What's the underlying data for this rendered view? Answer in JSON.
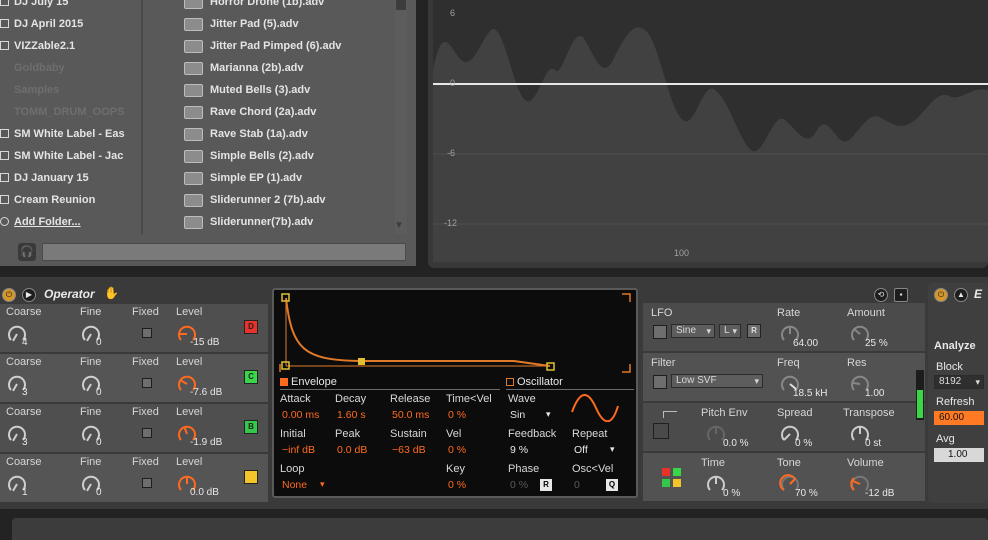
{
  "browser": {
    "places": [
      {
        "label": "DJ July 15",
        "checkbox": true,
        "dim": false
      },
      {
        "label": "DJ April 2015",
        "checkbox": true,
        "dim": false
      },
      {
        "label": "VIZZable2.1",
        "checkbox": true,
        "dim": false
      },
      {
        "label": "Goldbaby",
        "checkbox": false,
        "dim": true
      },
      {
        "label": "Samples",
        "checkbox": false,
        "dim": true
      },
      {
        "label": "TOMM_DRUM_OOPS",
        "checkbox": false,
        "dim": true
      },
      {
        "label": "SM White Label - Eas",
        "checkbox": true,
        "dim": false
      },
      {
        "label": "SM White Label - Jac",
        "checkbox": true,
        "dim": false
      },
      {
        "label": "DJ January 15",
        "checkbox": true,
        "dim": false
      },
      {
        "label": "Cream Reunion",
        "checkbox": true,
        "dim": false
      },
      {
        "label": "Add Folder...",
        "checkbox": false,
        "dim": false,
        "link": true
      }
    ],
    "files": [
      "Horror Drone (1b).adv",
      "Jitter Pad (5).adv",
      "Jitter Pad Pimped (6).adv",
      "Marianna (2b).adv",
      "Muted Bells (3).adv",
      "Rave Chord (2a).adv",
      "Rave Stab (1a).adv",
      "Simple Bells (2).adv",
      "Simple EP (1).adv",
      "Sliderunner 2 (7b).adv",
      "Sliderunner(7b).adv"
    ]
  },
  "spectrum": {
    "y_labels": [
      "6",
      "0",
      "-6",
      "-12"
    ],
    "x_label": "100"
  },
  "operator": {
    "title": "Operator",
    "oscillators": [
      {
        "coarse": "4",
        "fine": "0",
        "level": "-15 dB",
        "button": "D",
        "color": "#e8312a"
      },
      {
        "coarse": "3",
        "fine": "0",
        "level": "-7.6 dB",
        "button": "C",
        "color": "#3ad64a"
      },
      {
        "coarse": "3",
        "fine": "0",
        "level": "-1.9 dB",
        "button": "B",
        "color": "#34c84a"
      },
      {
        "coarse": "1",
        "fine": "0",
        "level": "0.0 dB",
        "button": "",
        "color": "#f4c52a"
      }
    ],
    "col_labels": {
      "coarse": "Coarse",
      "fine": "Fine",
      "fixed": "Fixed",
      "level": "Level"
    },
    "envelope": {
      "title": "Envelope",
      "attack_label": "Attack",
      "attack": "0.00 ms",
      "decay_label": "Decay",
      "decay": "1.60 s",
      "release_label": "Release",
      "release": "50.0 ms",
      "time_vel_label": "Time<Vel",
      "time_vel": "0 %",
      "initial_label": "Initial",
      "initial": "−inf dB",
      "peak_label": "Peak",
      "peak": "0.0 dB",
      "sustain_label": "Sustain",
      "sustain": "−63 dB",
      "vel_label": "Vel",
      "vel": "0 %",
      "loop_label": "Loop",
      "loop": "None",
      "key_label": "Key",
      "key": "0 %"
    },
    "oscillator": {
      "title": "Oscillator",
      "wave_label": "Wave",
      "wave": "Sin",
      "feedback_label": "Feedback",
      "feedback": "9 %",
      "repeat_label": "Repeat",
      "repeat": "Off",
      "phase_label": "Phase",
      "phase": "0 %",
      "phase_btn": "R",
      "osc_vel_label": "Osc<Vel",
      "osc_vel": "0",
      "osc_vel_btn": "Q"
    },
    "lfo": {
      "label": "LFO",
      "wave": "Sine",
      "mode": "L",
      "btn": "R",
      "rate_label": "Rate",
      "rate": "64.00",
      "amount_label": "Amount",
      "amount": "25 %"
    },
    "filter": {
      "label": "Filter",
      "type": "Low SVF",
      "freq_label": "Freq",
      "freq": "18.5 kH",
      "res_label": "Res",
      "res": "1.00"
    },
    "pitch": {
      "env_label": "Pitch Env",
      "env": "0.0 %",
      "spread_label": "Spread",
      "spread": "0 %",
      "transpose_label": "Transpose",
      "transpose": "0 st"
    },
    "global": {
      "time_label": "Time",
      "time": "0 %",
      "tone_label": "Tone",
      "tone": "70 %",
      "volume_label": "Volume",
      "volume": "-12 dB"
    }
  },
  "analyzer": {
    "title": "Analyze",
    "block_label": "Block",
    "block": "8192",
    "refresh_label": "Refresh",
    "refresh": "60.00",
    "avg_label": "Avg",
    "avg": "1.00"
  },
  "colors": {
    "accent": "#ff6a1e",
    "envelope": "#e07a28",
    "display_bg": "#0c0c0c"
  }
}
